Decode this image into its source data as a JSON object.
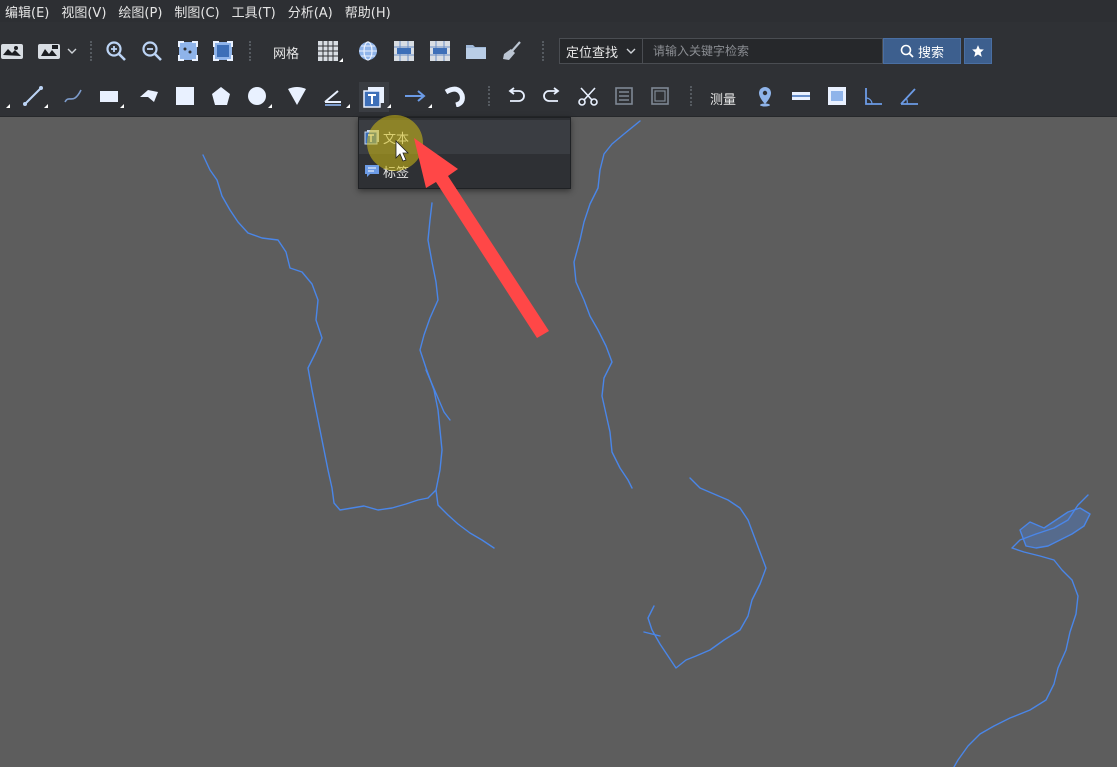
{
  "menubar": {
    "items": [
      "编辑(E)",
      "视图(V)",
      "绘图(P)",
      "制图(C)",
      "工具(T)",
      "分析(A)",
      "帮助(H)"
    ]
  },
  "toolbar1": {
    "grid_label": "网格",
    "search_mode": "定位查找",
    "search_placeholder": "请输入关键字检索",
    "search_button": "搜索"
  },
  "toolbar2": {
    "measure_label": "测量"
  },
  "text_dropdown": {
    "items": [
      {
        "label": "文本",
        "icon": "text-box-icon"
      },
      {
        "label": "标签",
        "icon": "label-speech-icon"
      }
    ]
  },
  "colors": {
    "menubar_bg": "#2d2f33",
    "toolbar_bg": "#2f3135",
    "map_bg": "#5d5d5d",
    "river": "#4a86e8",
    "accent_blue": "#3d5f8e",
    "highlight_yellow": "#d2be14",
    "arrow_red": "#ff4747"
  }
}
